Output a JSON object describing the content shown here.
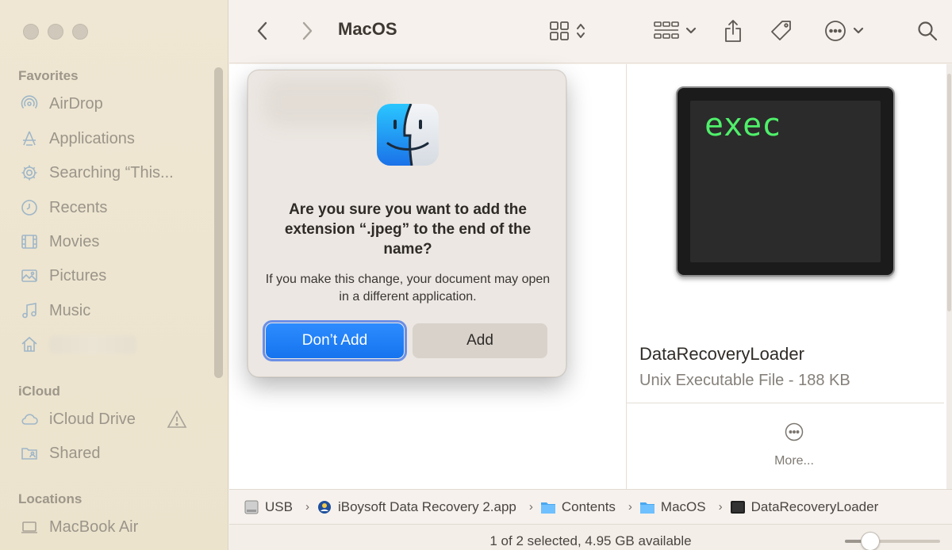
{
  "window": {
    "title": "MacOS"
  },
  "sidebar": {
    "favorites_header": "Favorites",
    "favorites": [
      {
        "label": "AirDrop",
        "icon": "airdrop-icon"
      },
      {
        "label": "Applications",
        "icon": "applications-icon"
      },
      {
        "label": "Searching “This...",
        "icon": "gear-icon"
      },
      {
        "label": "Recents",
        "icon": "clock-icon"
      },
      {
        "label": "Movies",
        "icon": "film-icon"
      },
      {
        "label": "Pictures",
        "icon": "photo-icon"
      },
      {
        "label": "Music",
        "icon": "music-note-icon"
      },
      {
        "label": "",
        "icon": "home-icon"
      }
    ],
    "icloud_header": "iCloud",
    "icloud": [
      {
        "label": "iCloud Drive",
        "icon": "cloud-icon"
      },
      {
        "label": "Shared",
        "icon": "shared-folder-icon"
      }
    ],
    "locations_header": "Locations",
    "locations": [
      {
        "label": "MacBook Air",
        "icon": "laptop-icon"
      }
    ]
  },
  "toolbar": {
    "back_icon": "chevron-left-icon",
    "forward_icon": "chevron-right-icon",
    "view_icon": "grid-view-icon",
    "group_icon": "group-icon",
    "share_icon": "share-icon",
    "tag_icon": "tag-icon",
    "more_icon": "ellipsis-circle-icon",
    "search_icon": "search-icon"
  },
  "dialog": {
    "icon": "finder-icon",
    "title": "Are you sure you want to add the extension “.jpeg” to the end of the name?",
    "message": "If you make this change, your document may open in a different application.",
    "primary_label": "Don’t Add",
    "secondary_label": "Add",
    "accent": "#1a7af0"
  },
  "preview": {
    "thumbnail_text": "exec",
    "name": "DataRecoveryLoader",
    "info": "Unix Executable File - 188 KB",
    "more_label": "More..."
  },
  "pathbar": {
    "crumbs": [
      {
        "label": "USB",
        "icon": "drive-icon"
      },
      {
        "label": "iBoysoft Data Recovery 2.app",
        "icon": "app-icon"
      },
      {
        "label": "Contents",
        "icon": "folder-icon"
      },
      {
        "label": "MacOS",
        "icon": "folder-icon"
      },
      {
        "label": "DataRecoveryLoader",
        "icon": "terminal-icon"
      }
    ]
  },
  "status": {
    "text": "1 of 2 selected, 4.95 GB available",
    "zoom": 0.27
  }
}
